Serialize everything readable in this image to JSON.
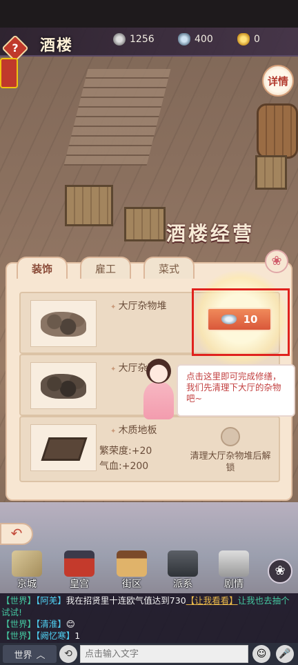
{
  "header": {
    "help_label": "?",
    "title": "酒楼",
    "detail_label": "详情",
    "resources": [
      {
        "name": "copper-coin-icon",
        "value": "1256"
      },
      {
        "name": "silver-ingot-icon",
        "value": "400"
      },
      {
        "name": "gold-ingot-icon",
        "value": "0"
      }
    ]
  },
  "banner": {
    "text": "酒楼经营"
  },
  "tabs": [
    {
      "label": "装饰",
      "active": true
    },
    {
      "label": "雇工",
      "active": false
    },
    {
      "label": "菜式",
      "active": false
    }
  ],
  "flower_icon": "❀",
  "items": [
    {
      "name": "大厅杂物堆"
    },
    {
      "name": "大厅杂物堆"
    },
    {
      "name": "木质地板",
      "stat1": "繁荣度:+20",
      "stat2": "气血:+200",
      "unlock_text": "清理大厅杂物堆后解锁"
    }
  ],
  "cost_button": {
    "value": "10",
    "icon": "silver-ingot-icon"
  },
  "tutorial": {
    "text": "点击这里即可完成修缮，我们先清理下大厅的杂物吧~"
  },
  "back_label": "↶",
  "nav": [
    {
      "label": "京城"
    },
    {
      "label": "皇宫"
    },
    {
      "label": "街区"
    },
    {
      "label": "派系"
    },
    {
      "label": "剧情"
    }
  ],
  "chat": {
    "lines": [
      {
        "channel": "【世界】",
        "name": "【阿羌】",
        "message": "我在招贤里十连欧气值达到730",
        "link": "【让我看看】",
        "tail": "让我也去抽个试试!"
      },
      {
        "channel": "【世界】",
        "name": "【清淮】",
        "message": "😊"
      },
      {
        "channel": "【世界】",
        "name": "【阙忆寒】",
        "message": "1"
      }
    ]
  },
  "input_bar": {
    "channel_label": "世界",
    "channel_arrow": "︿",
    "history_icon": "⟲",
    "placeholder": "点击输入文字",
    "emoji_icon": "☺",
    "mic_icon": "🎤"
  }
}
